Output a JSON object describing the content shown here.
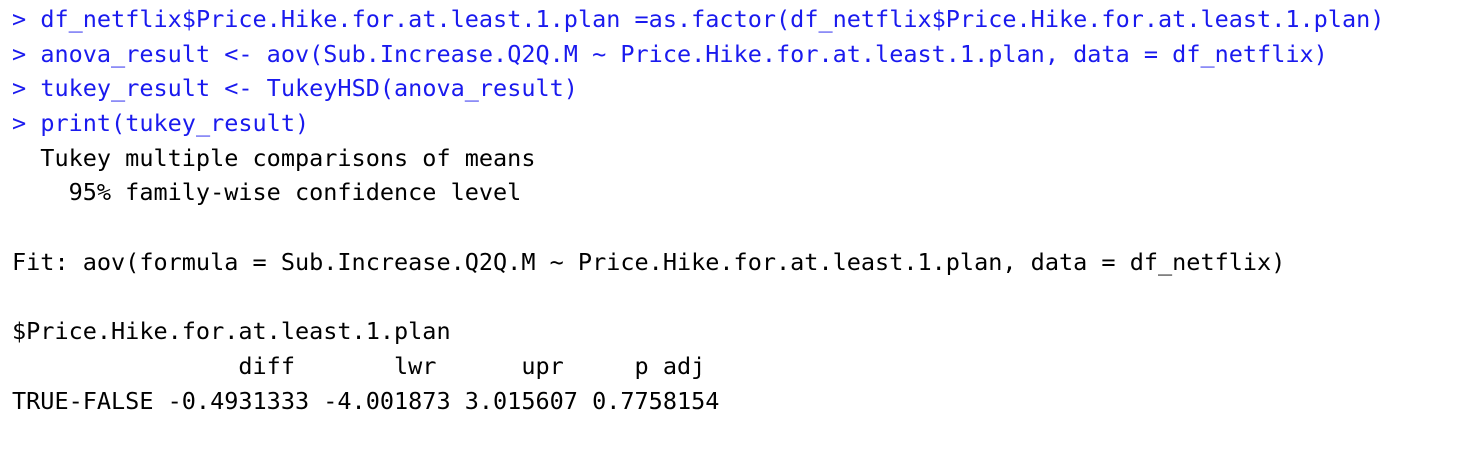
{
  "console": {
    "prompt_symbol": ">",
    "commands": [
      "df_netflix$Price.Hike.for.at.least.1.plan =as.factor(df_netflix$Price.Hike.for.at.least.1.plan)",
      "anova_result <- aov(Sub.Increase.Q2Q.M ~ Price.Hike.for.at.least.1.plan, data = df_netflix)",
      "tukey_result <- TukeyHSD(anova_result)",
      "print(tukey_result)"
    ],
    "output": {
      "header_line1": "  Tukey multiple comparisons of means",
      "header_line2": "    95% family-wise confidence level",
      "fit_line": "Fit: aov(formula = Sub.Increase.Q2Q.M ~ Price.Hike.for.at.least.1.plan, data = df_netflix)",
      "section_name": "$Price.Hike.for.at.least.1.plan",
      "table_header": "                diff       lwr      upr     p adj",
      "table_row": "TRUE-FALSE -0.4931333 -4.001873 3.015607 0.7758154"
    },
    "colors": {
      "command": "#1a1aee",
      "output": "#000000",
      "background": "#ffffff"
    }
  }
}
